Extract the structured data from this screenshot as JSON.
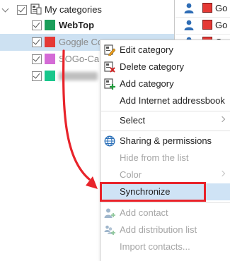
{
  "tree": {
    "root_label": "My categories",
    "items": [
      {
        "label": "WebTop",
        "color": "#1a9e5a"
      },
      {
        "label": "Goggle Co",
        "color": "#e53935"
      },
      {
        "label": "SOGo-Ca",
        "color": "#d46bd6"
      },
      {
        "label": "",
        "color": "#19c78c"
      }
    ]
  },
  "list": {
    "rows": [
      {
        "text": "Go",
        "icon": "person-icon"
      },
      {
        "text": "Go",
        "icon": "person-icon"
      },
      {
        "text": "Go",
        "icon": "person-icon"
      }
    ],
    "accent": "#e53935"
  },
  "menu": {
    "items": [
      {
        "label": "Edit category",
        "icon": "edit-category-icon",
        "enabled": true
      },
      {
        "label": "Delete category",
        "icon": "delete-category-icon",
        "enabled": true
      },
      {
        "label": "Add category",
        "icon": "add-category-icon",
        "enabled": true
      },
      {
        "label": "Add Internet addressbook",
        "enabled": true
      },
      {
        "label": "Select",
        "enabled": true,
        "submenu": true
      },
      {
        "label": "Sharing & permissions",
        "icon": "globe-icon",
        "enabled": true
      },
      {
        "label": "Hide from the list",
        "enabled": false
      },
      {
        "label": "Color",
        "enabled": false,
        "submenu": true
      },
      {
        "label": "Synchronize",
        "enabled": true,
        "highlighted": true
      },
      {
        "label": "Add contact",
        "icon": "add-contact-icon",
        "enabled": false
      },
      {
        "label": "Add distribution list",
        "icon": "add-distribution-list-icon",
        "enabled": false
      },
      {
        "label": "Import contacts...",
        "enabled": false
      }
    ]
  },
  "annotation": {
    "box_color": "#e8232a",
    "arrow_color": "#e8232a"
  }
}
